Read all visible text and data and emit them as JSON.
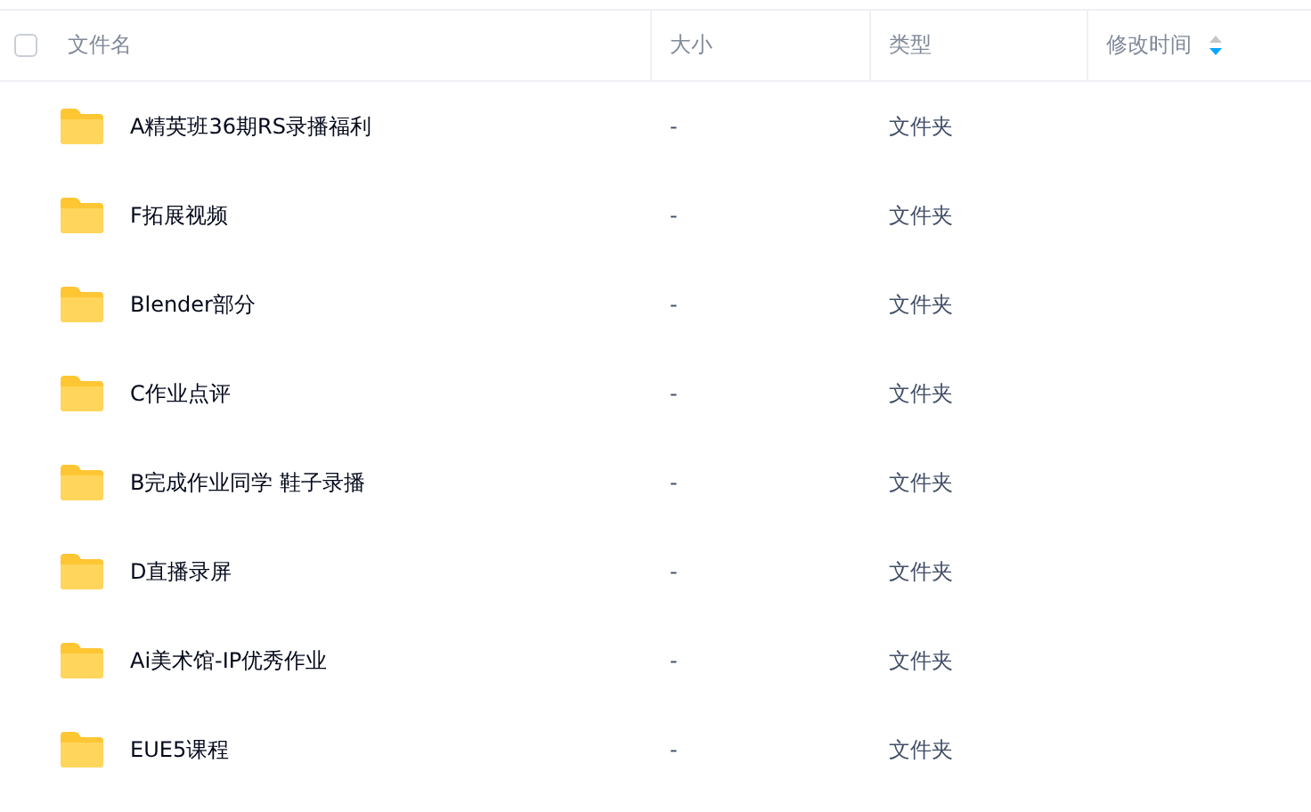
{
  "header": {
    "select_all": {
      "checked": false
    },
    "columns": [
      {
        "label": "文件名",
        "sorted": false
      },
      {
        "label": "大小",
        "sorted": false
      },
      {
        "label": "类型",
        "sorted": false
      },
      {
        "label": "修改时间",
        "sorted": true
      }
    ]
  },
  "rows": [
    {
      "name": "A精英班36期RS录播福利",
      "size": "-",
      "type": "文件夹"
    },
    {
      "name": "F拓展视频",
      "size": "-",
      "type": "文件夹"
    },
    {
      "name": "Blender部分",
      "size": "-",
      "type": "文件夹"
    },
    {
      "name": "C作业点评",
      "size": "-",
      "type": "文件夹"
    },
    {
      "name": "B完成作业同学 鞋子录播",
      "size": "-",
      "type": "文件夹"
    },
    {
      "name": "D直播录屏",
      "size": "-",
      "type": "文件夹"
    },
    {
      "name": "Ai美术馆-IP优秀作业",
      "size": "-",
      "type": "文件夹"
    },
    {
      "name": "EUE5课程",
      "size": "-",
      "type": "文件夹"
    }
  ]
}
